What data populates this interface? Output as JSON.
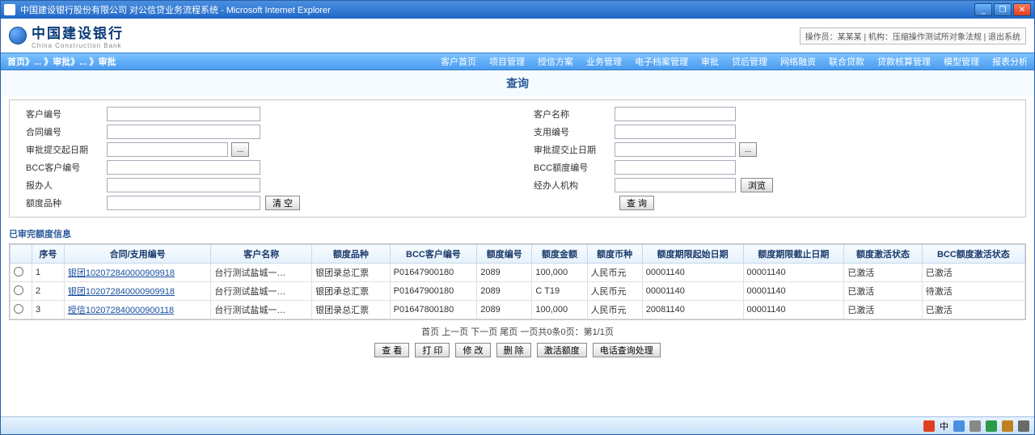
{
  "titlebar": {
    "title": "中国建设银行股份有限公司 对公信贷业务流程系统 - Microsoft Internet Explorer"
  },
  "logo": {
    "name": "中国建设银行",
    "sub": "China Construction Bank"
  },
  "topright": "操作员：某某某 | 机构：压缩操作测试所对象法规 | 退出系统",
  "crumb": "首页》... 》审批》... 》审批",
  "menus": [
    "客户首页",
    "项目管理",
    "授信方案",
    "业务管理",
    "电子档案管理",
    "审批",
    "贷后管理",
    "网络融资",
    "联合贷款",
    "贷款核算管理",
    "模型管理",
    "报表分析"
  ],
  "section_title": "查询",
  "form": {
    "l1": "客户编号",
    "r1": "客户名称",
    "l2": "合同编号",
    "r2": "支用编号",
    "l3": "审批提交起日期",
    "r3": "审批提交止日期",
    "l4": "BCC客户编号",
    "r4": "BCC额度编号",
    "l5": "报办人",
    "r5": "经办人机构",
    "l6": "额度品种",
    "btn_date": "...",
    "btn_browse": "浏览",
    "btn_reset": "清 空",
    "btn_query": "查 询"
  },
  "list_title": "已审完额度信息",
  "columns": [
    "",
    "序号",
    "合同/支用编号",
    "客户名称",
    "额度品种",
    "BCC客户编号",
    "额度编号",
    "额度金额",
    "额度币种",
    "额度期限起始日期",
    "额度期限截止日期",
    "额度激活状态",
    "BCC额度激活状态"
  ],
  "rows": [
    {
      "no": "1",
      "c1": "银团102072840000909918",
      "c2": "台行测试盐城一…",
      "c3": "银团录总汇票",
      "c4": "P01647900180",
      "c5": "2089",
      "c6": "100,000",
      "c7": "人民币元",
      "c8": "00001140",
      "c9": "00001140",
      "c10": "已激活",
      "c11": "已激活"
    },
    {
      "no": "2",
      "c1": "银团102072840000909918",
      "c2": "台行测试盐城一…",
      "c3": "银团承总汇票",
      "c4": "P01647900180",
      "c5": "2089",
      "c6": "C T19",
      "c7": "人民币元",
      "c8": "00001140",
      "c9": "00001140",
      "c10": "已激活",
      "c11": "待激活"
    },
    {
      "no": "3",
      "c1": "授信102072840000900118",
      "c2": "台行测试盐城一…",
      "c3": "银团录总汇票",
      "c4": "P01647800180",
      "c5": "2089",
      "c6": "100,000",
      "c7": "人民币元",
      "c8": "20081140",
      "c9": "00001140",
      "c10": "已激活",
      "c11": "已激活"
    }
  ],
  "pager": "首页 上一页 下一页 尾页 一页共0条0页：第1/1页",
  "pagbtns": {
    "view": "查 看",
    "print": "打 印",
    "change": "修 改",
    "del": "删 除",
    "act": "激活额度",
    "bcc": "电话查询处理"
  }
}
